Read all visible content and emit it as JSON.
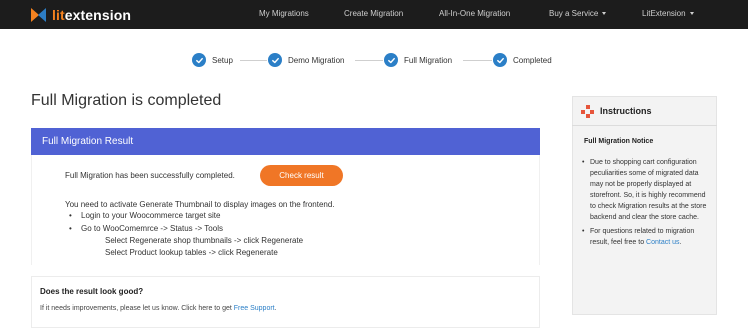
{
  "brand": {
    "lit": "lit",
    "ext": "extension",
    "orange": "#f5821f",
    "blue": "#2d7dc4"
  },
  "nav": {
    "items": [
      {
        "label": "My Migrations"
      },
      {
        "label": "Create Migration"
      },
      {
        "label": "All-In-One Migration"
      },
      {
        "label": "Buy a Service",
        "dropdown": true
      },
      {
        "label": "LitExtension",
        "dropdown": true
      }
    ]
  },
  "stepper": {
    "steps": [
      {
        "label": "Setup",
        "status": "done"
      },
      {
        "label": "Demo Migration",
        "status": "done"
      },
      {
        "label": "Full Migration",
        "status": "done"
      },
      {
        "label": "Completed",
        "status": "done"
      }
    ],
    "accent": "#2b7fc7"
  },
  "page": {
    "title": "Full Migration is completed"
  },
  "result": {
    "header": "Full Migration Result",
    "header_color": "#5062d4",
    "success_text": "Full Migration has been successfully completed.",
    "check_button": "Check result",
    "button_color": "#f07626",
    "note": "You need to activate Generate Thumbnail to display images on the frontend.",
    "bullets": [
      "Login to your Woocommerce target site",
      "Go to WooComemrce -> Status -> Tools"
    ],
    "sub_steps": [
      "Select Regenerate shop thumbnails -> click Regenerate",
      "Select Product lookup tables -> click Regenerate"
    ]
  },
  "feedback": {
    "title": "Does the result look good?",
    "text": "If it needs improvements, please let us know. Click here to get ",
    "link": "Free Support",
    "end": "."
  },
  "instructions": {
    "title": "Instructions",
    "notice_title": "Full Migration Notice",
    "items": [
      {
        "text": "Due to shopping cart configuration peculiarities some of migrated data may not be properly displayed at storefront. So, it is highly recommend to check Migration results at the store backend and clear the store cache."
      },
      {
        "text": "For questions related to migration result, feel free to ",
        "link": "Contact us",
        "end": "."
      }
    ]
  }
}
